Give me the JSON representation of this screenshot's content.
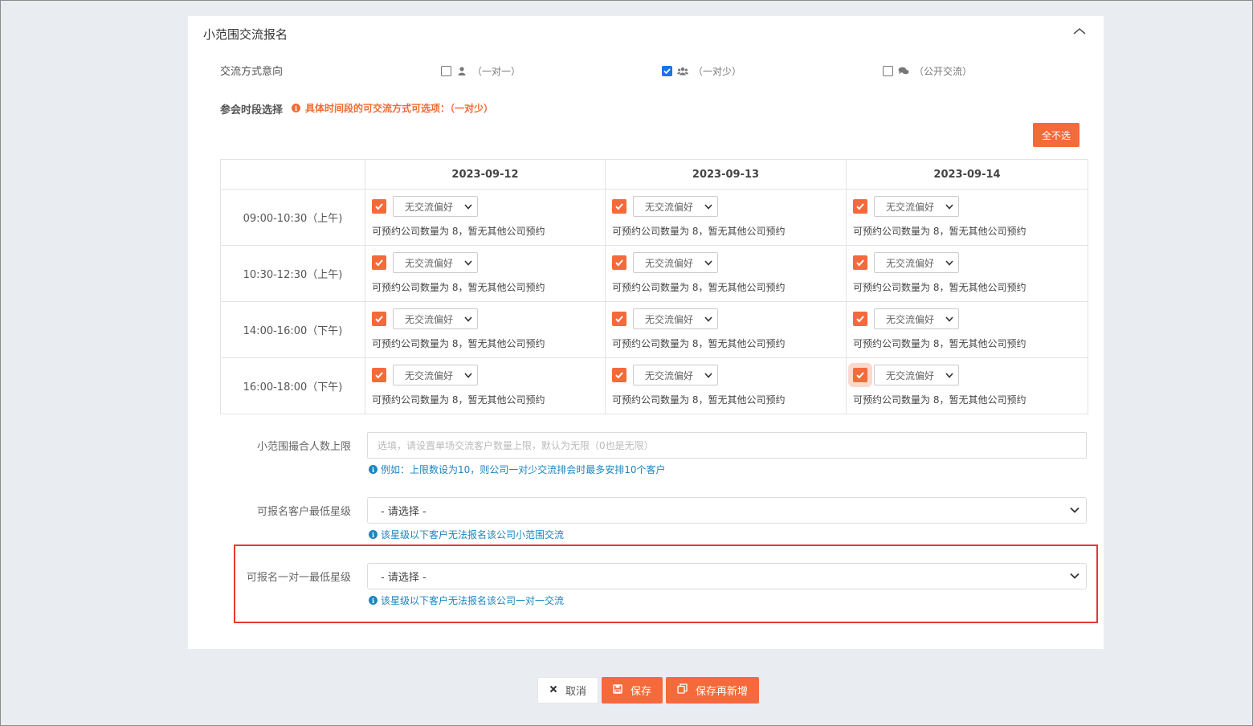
{
  "panel": {
    "title": "小范围交流报名"
  },
  "mode": {
    "label": "交流方式意向",
    "options": [
      {
        "label": "（一对一）",
        "checked": false,
        "icon": "user-icon"
      },
      {
        "label": "（一对少）",
        "checked": true,
        "icon": "users-icon"
      },
      {
        "label": "（公开交流）",
        "checked": false,
        "icon": "comments-icon"
      }
    ]
  },
  "slots": {
    "label": "参会时段选择",
    "hint": "具体时间段的可交流方式可选项：（一对少）",
    "deselect_all": "全不选",
    "dates": [
      "2023-09-12",
      "2023-09-13",
      "2023-09-14"
    ],
    "times": [
      "09:00-10:30（上午)",
      "10:30-12:30（上午)",
      "14:00-16:00（下午)",
      "16:00-18:00（下午)"
    ],
    "select_value": "无交流偏好",
    "note": "可预约公司数量为 8，暂无其他公司预约"
  },
  "limit": {
    "label": "小范围撮合人数上限",
    "placeholder": "选填，请设置单场交流客户数量上限，默认为无限（0也是无限）",
    "hint": "例如：上限数设为10，则公司一对少交流排会时最多安排10个客户"
  },
  "min_star": {
    "label": "可报名客户最低星级",
    "value": "- 请选择 -",
    "hint": "该星级以下客户无法报名该公司小范围交流"
  },
  "min_star_one": {
    "label": "可报名一对一最低星级",
    "value": "- 请选择 -",
    "hint": "该星级以下客户无法报名该公司一对一交流"
  },
  "actions": {
    "cancel": "取消",
    "save": "保存",
    "save_new": "保存再新增"
  },
  "colors": {
    "accent": "#f56a3a",
    "link": "#1b86c0",
    "highlight": "#e53935"
  }
}
